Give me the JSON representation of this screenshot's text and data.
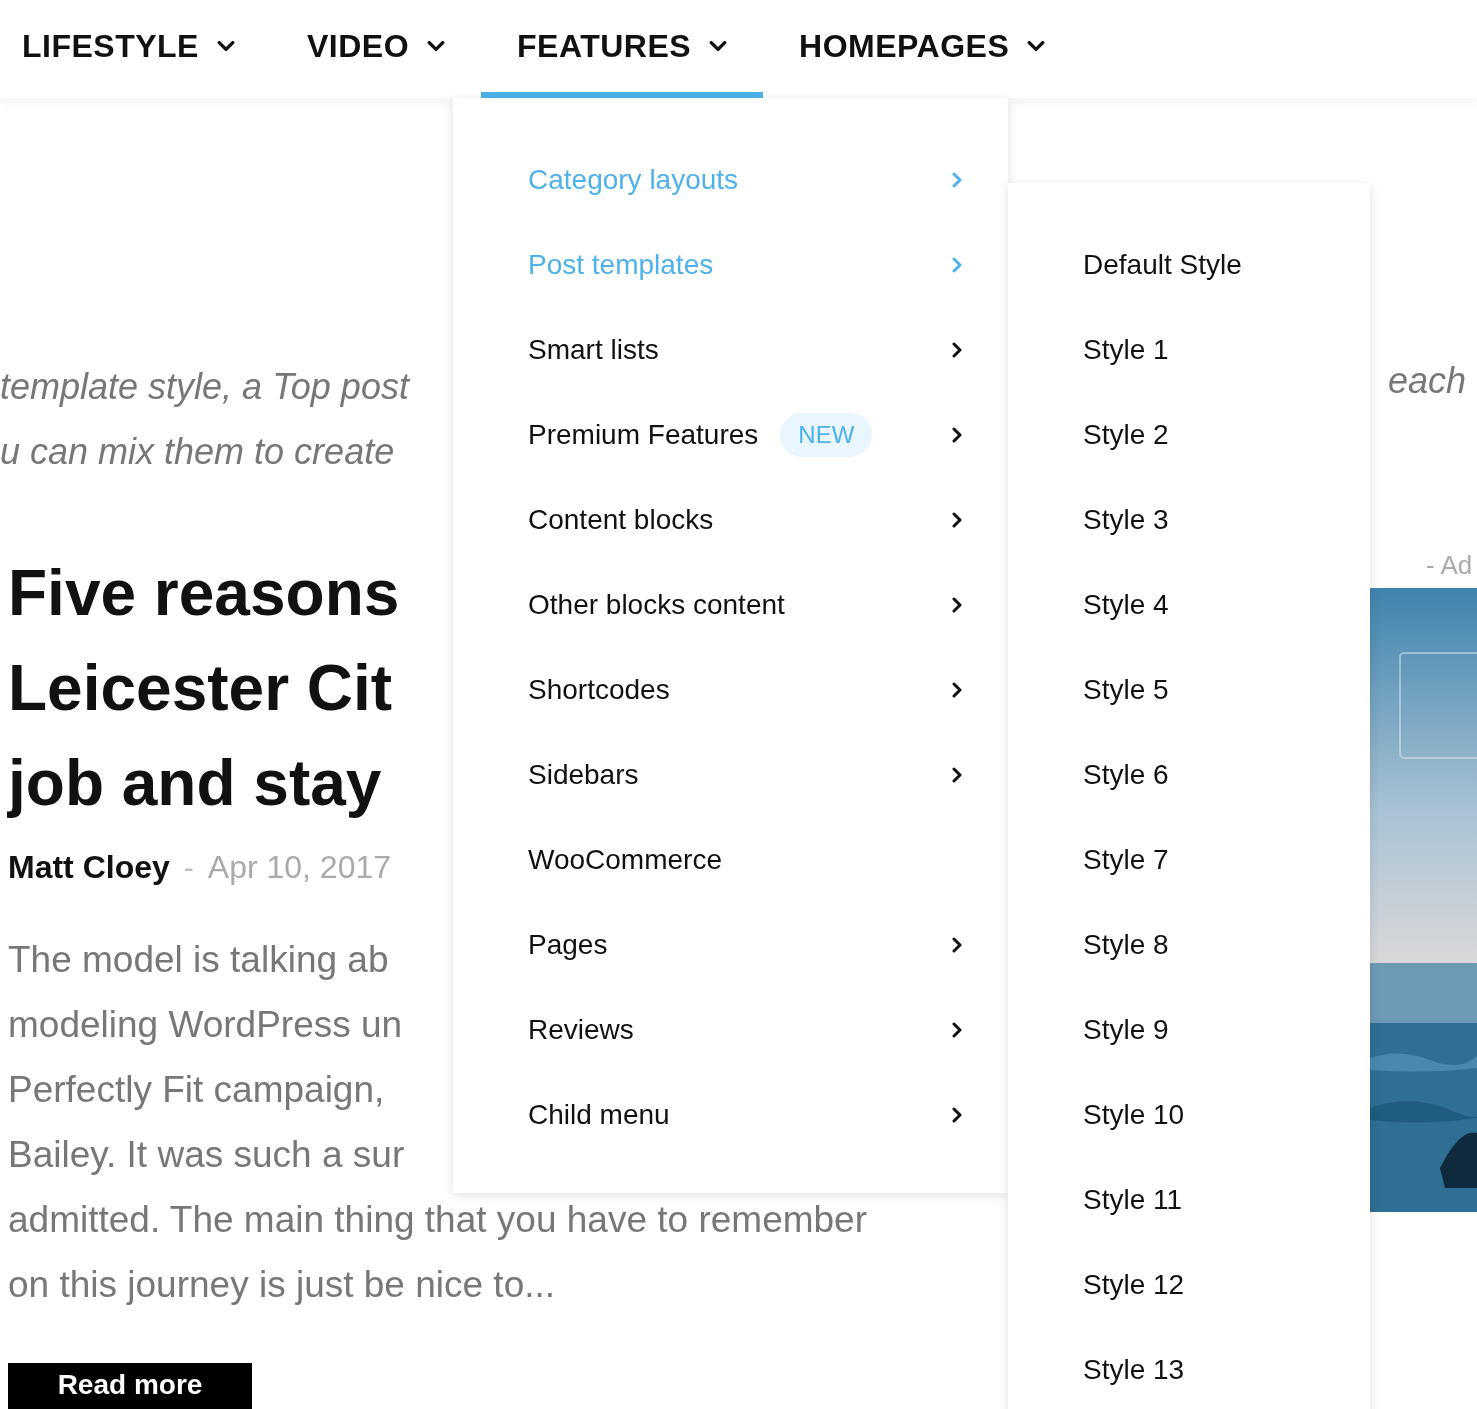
{
  "nav": [
    {
      "label": "LIFESTYLE",
      "selected": false
    },
    {
      "label": "VIDEO",
      "selected": false
    },
    {
      "label": "FEATURES",
      "selected": true
    },
    {
      "label": "HOMEPAGES",
      "selected": false
    }
  ],
  "intro": {
    "left_lines": [
      "template style, a Top post",
      "u can mix them to create"
    ],
    "right_line": "each"
  },
  "article": {
    "title_lines": [
      "Five reasons",
      "Leicester Cit",
      "job and stay"
    ],
    "author": "Matt Cloey",
    "separator": "-",
    "date": "Apr 10, 2017",
    "excerpt_lines": [
      "The model is talking ab",
      "modeling WordPress un",
      "Perfectly Fit campaign,",
      "Bailey. It was such a sur",
      "admitted. The main thing that you have to remember",
      "on this journey is just be nice to..."
    ],
    "button": "Read more"
  },
  "ad": {
    "label": "- Ad",
    "kind": "picture"
  },
  "menu": [
    {
      "label": "Category layouts",
      "highlighted": true,
      "has_submenu": true
    },
    {
      "label": "Post templates",
      "highlighted": true,
      "has_submenu": true
    },
    {
      "label": "Smart lists",
      "highlighted": false,
      "has_submenu": true
    },
    {
      "label": "Premium Features",
      "badge": "NEW",
      "highlighted": false,
      "has_submenu": true
    },
    {
      "label": "Content blocks",
      "highlighted": false,
      "has_submenu": true
    },
    {
      "label": "Other blocks content",
      "highlighted": false,
      "has_submenu": true
    },
    {
      "label": "Shortcodes",
      "highlighted": false,
      "has_submenu": true
    },
    {
      "label": "Sidebars",
      "highlighted": false,
      "has_submenu": true
    },
    {
      "label": "WooCommerce",
      "highlighted": false,
      "has_submenu": false
    },
    {
      "label": "Pages",
      "highlighted": false,
      "has_submenu": true
    },
    {
      "label": "Reviews",
      "highlighted": false,
      "has_submenu": true
    },
    {
      "label": "Child menu",
      "highlighted": false,
      "has_submenu": true
    }
  ],
  "submenu": [
    "Default Style",
    "Style 1",
    "Style 2",
    "Style 3",
    "Style 4",
    "Style 5",
    "Style 6",
    "Style 7",
    "Style 8",
    "Style 9",
    "Style 10",
    "Style 11",
    "Style 12",
    "Style 13"
  ]
}
